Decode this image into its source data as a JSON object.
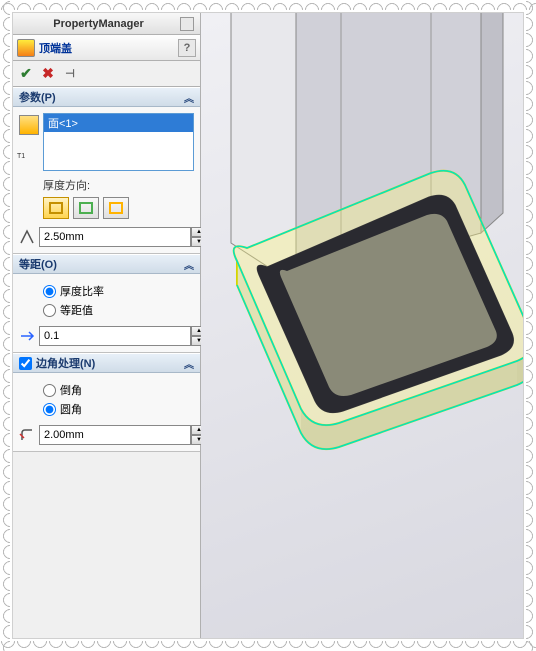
{
  "header": {
    "title": "PropertyManager"
  },
  "feature": {
    "title": "顶端盖",
    "help": "?"
  },
  "actions": {
    "ok": "✔",
    "cancel": "✖",
    "pin": "⊣"
  },
  "sections": {
    "params": {
      "title": "参数(P)",
      "selection_label": "T1",
      "selection_item": "面<1>",
      "thickness_dir_label": "厚度方向:",
      "thickness_value": "2.50mm"
    },
    "offset": {
      "title": "等距(O)",
      "radio1": "厚度比率",
      "radio2": "等距值",
      "offset_value": "0.1"
    },
    "corner": {
      "title": "边角处理(N)",
      "radio1": "倒角",
      "radio2": "圆角",
      "corner_value": "2.00mm"
    }
  }
}
